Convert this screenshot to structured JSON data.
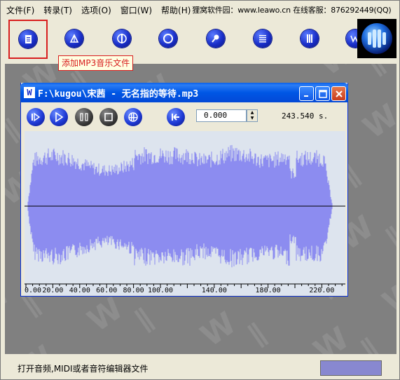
{
  "menubar": {
    "items": [
      "文件(F)",
      "转录(T)",
      "选项(O)",
      "窗口(W)",
      "帮助(H)"
    ],
    "site_info": "狸窝软件园：www.leawo.cn 在线客服：876292449(QQ)"
  },
  "toolbar": {
    "buttons": [
      {
        "icon": "add-mp3-icon"
      },
      {
        "icon": "edit-icon"
      },
      {
        "icon": "split-icon"
      },
      {
        "icon": "circle-icon"
      },
      {
        "icon": "search-icon"
      },
      {
        "icon": "list-icon"
      },
      {
        "icon": "bars-icon"
      },
      {
        "icon": "w-icon"
      }
    ],
    "tooltip": "添加MP3音乐文件"
  },
  "child_window": {
    "title": "F:\\kugou\\宋茜 - 无名指的等待.mp3",
    "icon_letter": "W",
    "position_value": "0.000",
    "duration": "243.540 s."
  },
  "waveform": {
    "color": "#8c8cf0",
    "axis_labels": [
      "0.00",
      "20.00",
      "40.00",
      "60.00",
      "80.00",
      "100.00",
      "140.00",
      "180.00",
      "220.00"
    ],
    "axis_values": [
      0,
      20,
      40,
      60,
      80,
      100,
      140,
      180,
      220
    ]
  },
  "status": {
    "text": "打开音频,MIDI或者音符编辑器文件"
  }
}
